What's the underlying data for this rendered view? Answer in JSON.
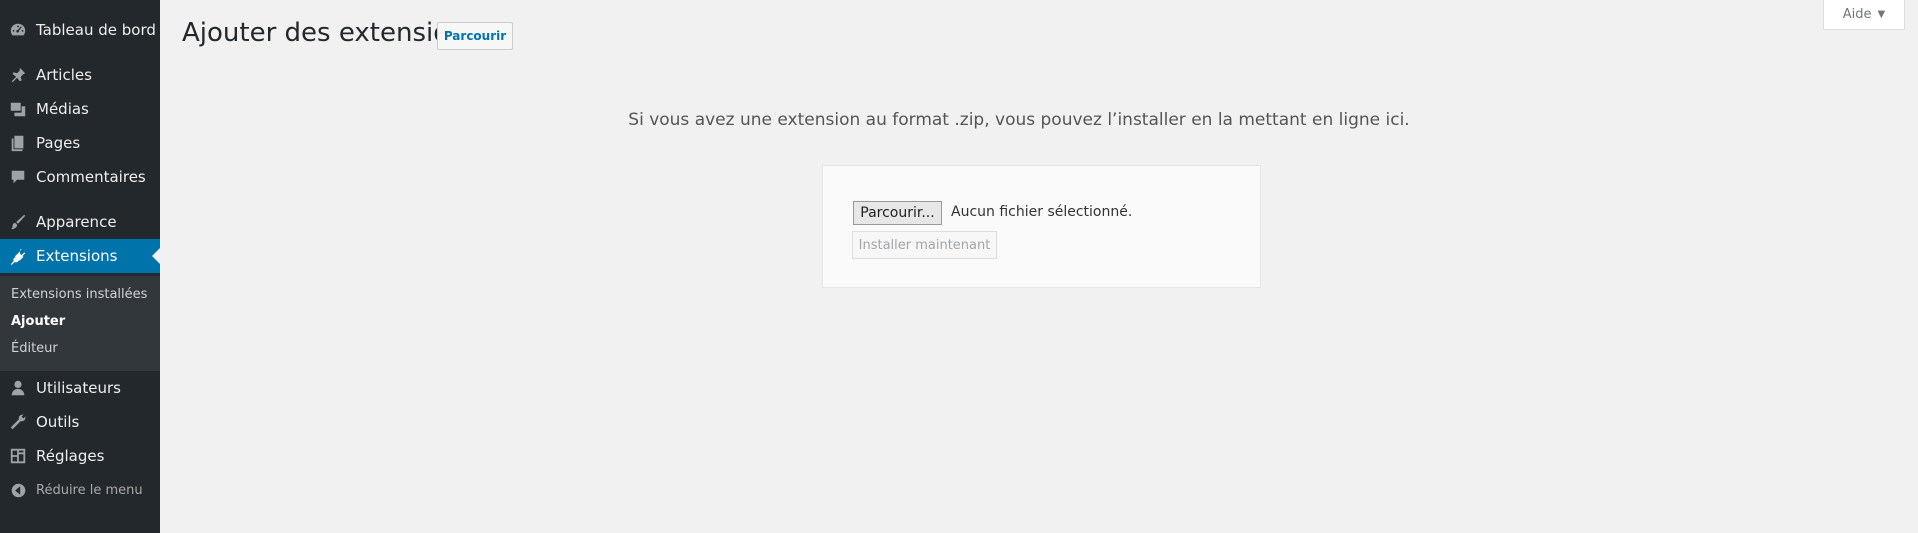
{
  "sidebar": {
    "items": [
      {
        "label": "Tableau de bord",
        "icon": "dashboard-icon"
      },
      {
        "label": "Articles",
        "icon": "pin-icon"
      },
      {
        "label": "Médias",
        "icon": "media-icon"
      },
      {
        "label": "Pages",
        "icon": "pages-icon"
      },
      {
        "label": "Commentaires",
        "icon": "comment-icon"
      },
      {
        "label": "Apparence",
        "icon": "brush-icon"
      },
      {
        "label": "Extensions",
        "icon": "plugin-icon"
      },
      {
        "label": "Utilisateurs",
        "icon": "user-icon"
      },
      {
        "label": "Outils",
        "icon": "wrench-icon"
      },
      {
        "label": "Réglages",
        "icon": "settings-icon"
      }
    ],
    "submenu": [
      {
        "label": "Extensions installées"
      },
      {
        "label": "Ajouter"
      },
      {
        "label": "Éditeur"
      }
    ],
    "collapse_label": "Réduire le menu"
  },
  "header": {
    "title": "Ajouter des extensions",
    "browse_label": "Parcourir",
    "help_label": "Aide",
    "help_caret": "▼"
  },
  "upload": {
    "help_text": "Si vous avez une extension au format .zip, vous pouvez l’installer en la mettant en ligne ici.",
    "file_button": "Parcourir...",
    "file_status": "Aucun fichier sélectionné.",
    "install_button": "Installer maintenant"
  },
  "colors": {
    "sidebar_bg": "#23282d",
    "submenu_bg": "#32373c",
    "active_bg": "#0073aa",
    "page_bg": "#f1f1f1",
    "link": "#0073aa"
  }
}
